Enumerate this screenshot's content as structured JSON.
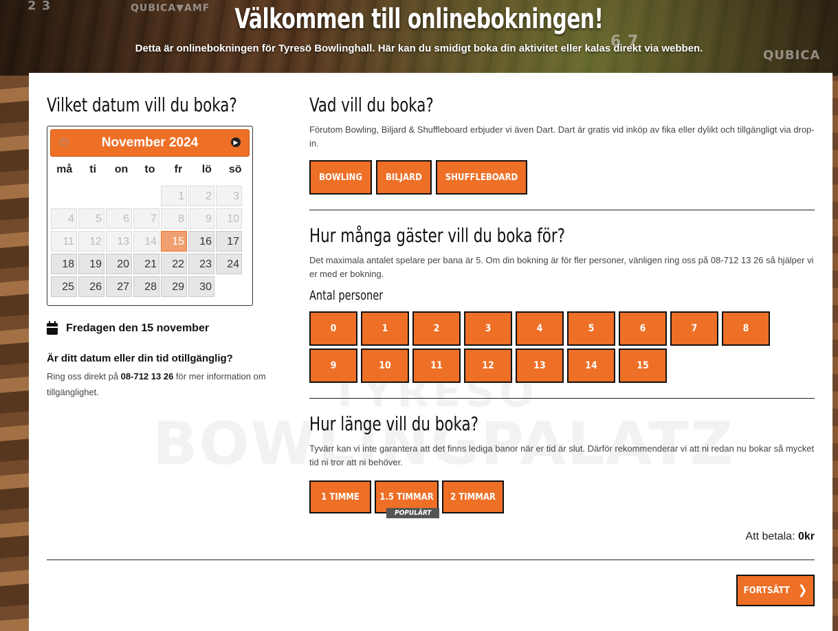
{
  "header": {
    "title": "Välkommen till onlinebokningen!",
    "subtitle": "Detta är onlinebokningen för Tyresö Bowlinghall. Här kan du smidigt boka din aktivitet eller kalas direkt via webben."
  },
  "background": {
    "brand_left": "QUBICA▼AMF",
    "brand_right": "QUBICA",
    "lane_numbers": "2 3",
    "lane_numbers_right": "6 7"
  },
  "watermark": {
    "top": "TYRESÖ",
    "bottom": "BOWLINGPALATZ"
  },
  "date_section": {
    "heading": "Vilket datum vill du boka?",
    "calendar": {
      "month_label": "November 2024",
      "prev_icon": "prev-icon",
      "next_icon": "next-icon",
      "weekdays": [
        "må",
        "ti",
        "on",
        "to",
        "fr",
        "lö",
        "sö"
      ],
      "weeks": [
        [
          "",
          "",
          "",
          "",
          "1",
          "2",
          "3"
        ],
        [
          "4",
          "5",
          "6",
          "7",
          "8",
          "9",
          "10"
        ],
        [
          "11",
          "12",
          "13",
          "14",
          "15",
          "16",
          "17"
        ],
        [
          "18",
          "19",
          "20",
          "21",
          "22",
          "23",
          "24"
        ],
        [
          "25",
          "26",
          "27",
          "28",
          "29",
          "30",
          ""
        ]
      ],
      "selected_day": "15",
      "first_available_day": 15
    },
    "selected_date_text": "Fredagen den 15 november",
    "unavailable_question": "Är ditt datum eller din tid otillgänglig?",
    "unavailable_text_before": "Ring oss direkt på ",
    "phone": "08-712 13 26",
    "unavailable_text_after": " för mer information om tillgänglighet."
  },
  "activity_section": {
    "heading": "Vad vill du boka?",
    "description": "Förutom Bowling, Biljard & Shuffleboard erbjuder vi även Dart. Dart är gratis vid inköp av fika eller dylikt och tillgängligt via drop-in.",
    "options": [
      "BOWLING",
      "BILJARD",
      "SHUFFLEBOARD"
    ]
  },
  "guests_section": {
    "heading": "Hur många gäster vill du boka för?",
    "description": "Det maximala antalet spelare per bana är 5. Om din bokning är för fler personer, vänligen ring oss på 08-712 13 26 så hjälper vi er med er bokning.",
    "count_label": "Antal personer",
    "counts": [
      "0",
      "1",
      "2",
      "3",
      "4",
      "5",
      "6",
      "7",
      "8",
      "9",
      "10",
      "11",
      "12",
      "13",
      "14",
      "15"
    ]
  },
  "duration_section": {
    "heading": "Hur länge vill du boka?",
    "description": "Tyvärr kan vi inte garantera att det finns lediga banor när er tid är slut. Därför rekommenderar vi att ni redan nu bokar så mycket tid ni tror att ni behöver.",
    "options": [
      "1 TIMME",
      "1.5 TIMMAR",
      "2 TIMMAR"
    ],
    "popular_badge": "POPULÄRT"
  },
  "payment": {
    "label": "Att betala:",
    "amount": "0kr"
  },
  "continue_button": {
    "label": "FORTSÄTT",
    "icon": "chevron-right-icon"
  },
  "colors": {
    "accent": "#ee6f26",
    "text": "#111111",
    "panel": "#ffffff"
  }
}
